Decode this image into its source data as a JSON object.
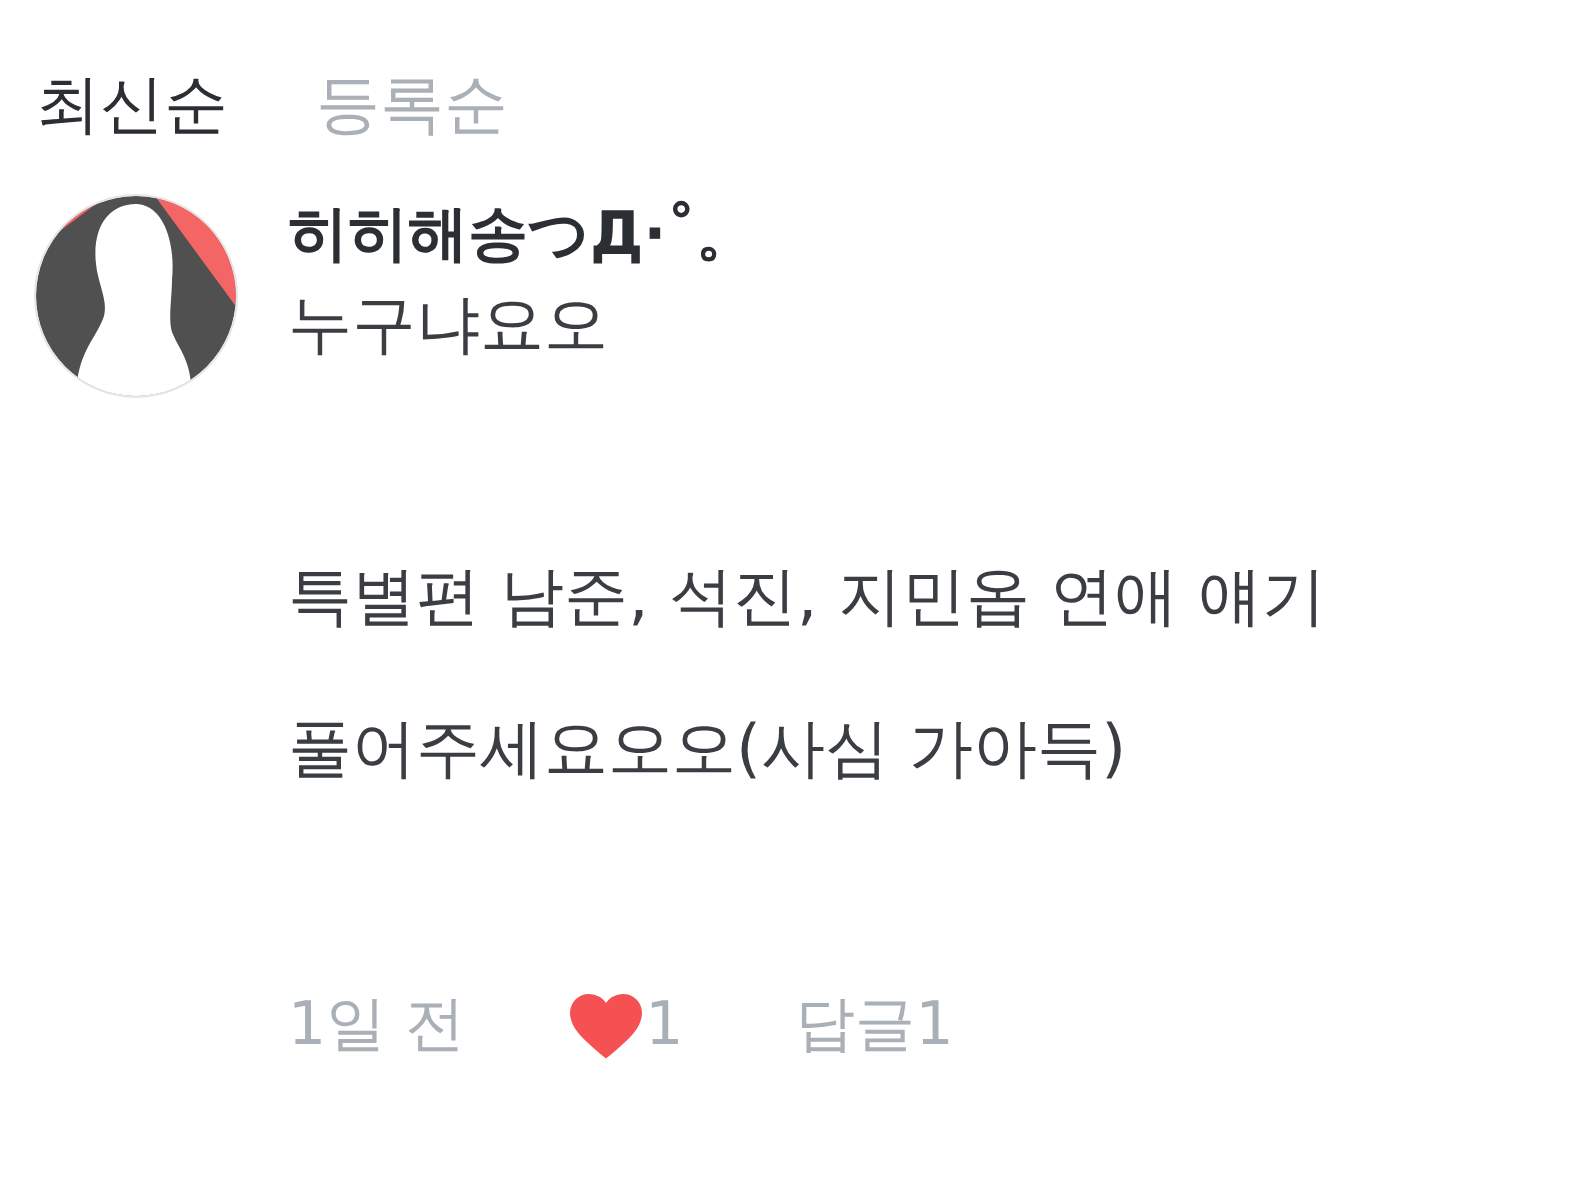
{
  "tabs": [
    {
      "label": "최신순",
      "selected": true
    },
    {
      "label": "등록순",
      "selected": false
    }
  ],
  "comments": [
    {
      "author": "히히해송つД·˚。",
      "paragraphs": [
        [
          "누구냐요오"
        ],
        [
          "특별편 남준, 석진, 지민옵 연애 얘기",
          "풀어주세요오오(사심 가아득)"
        ]
      ],
      "time": "1일 전",
      "liked": true,
      "likes": "1",
      "replies": "답글1"
    }
  ]
}
